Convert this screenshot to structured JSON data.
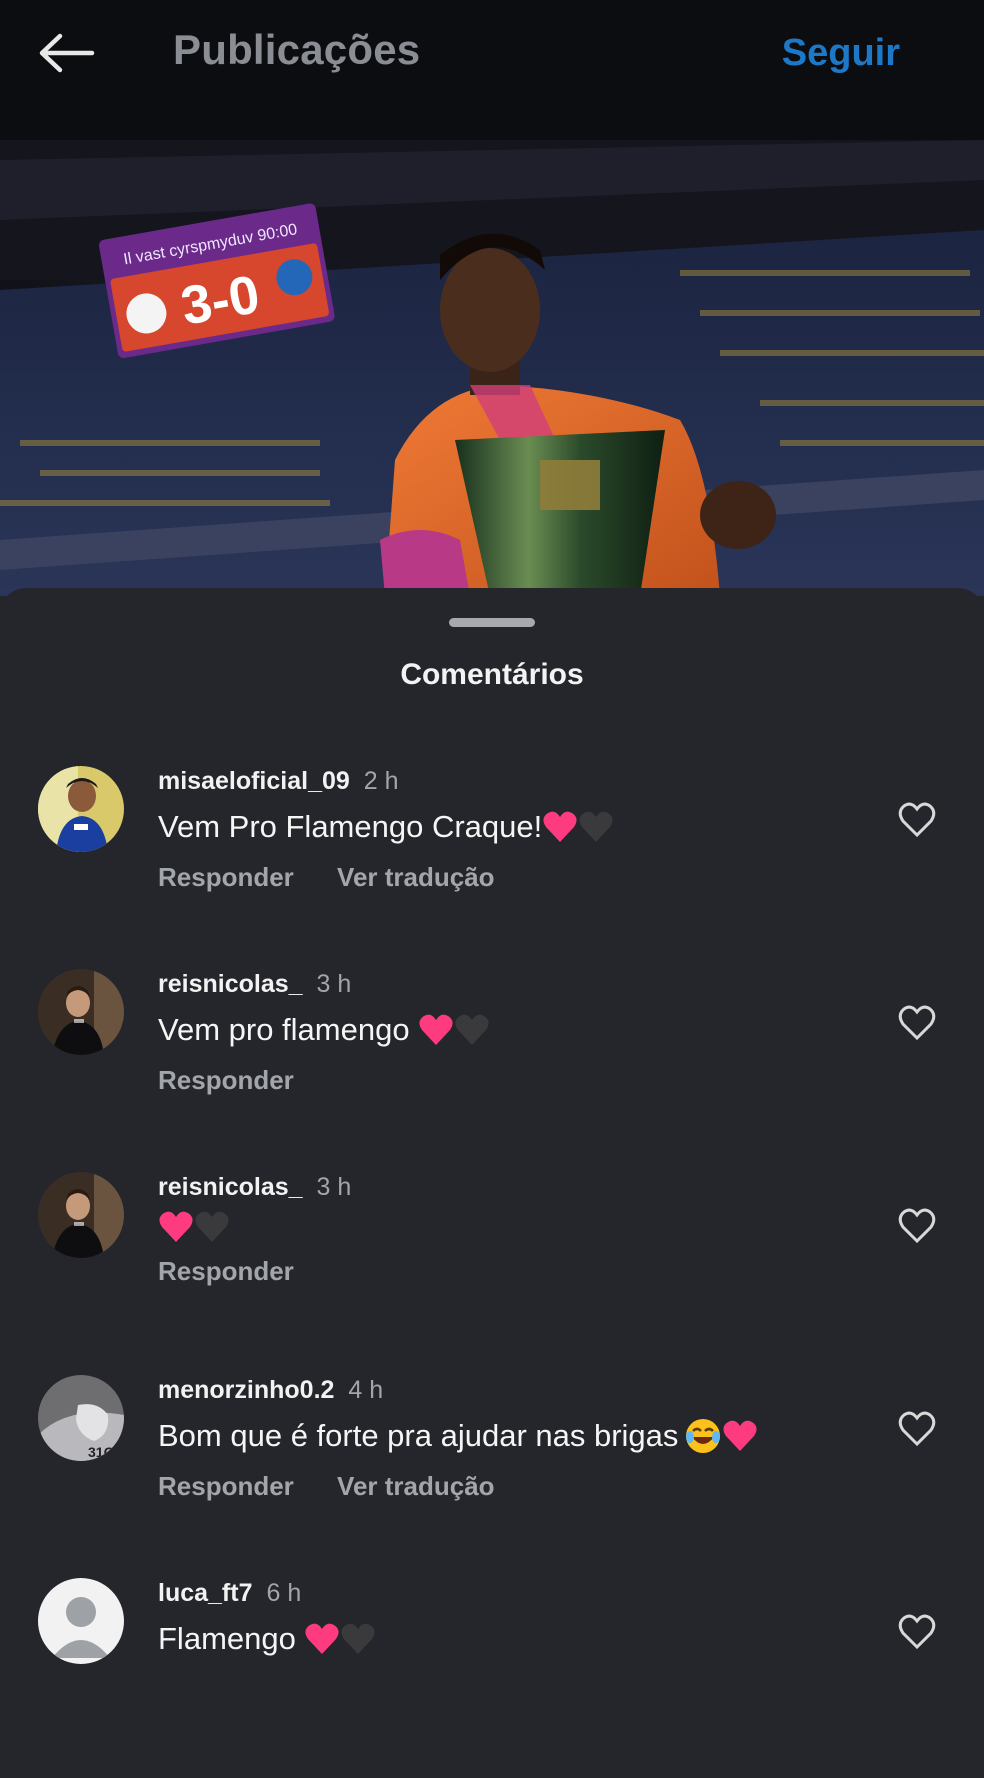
{
  "header": {
    "title": "Publicações",
    "follow_label": "Seguir"
  },
  "post": {
    "scoreboard_text": "3-0",
    "scoreboard_caption": "Il vast cyrspmyduv 90:00"
  },
  "sheet": {
    "title": "Comentários"
  },
  "comments": [
    {
      "username": "misaeloficial_09",
      "time": "2 h",
      "text": "Vem Pro Flamengo Craque!",
      "reply": "Responder",
      "translate": "Ver tradução"
    },
    {
      "username": "reisnicolas_",
      "time": "3 h",
      "text": "Vem pro flamengo ",
      "reply": "Responder"
    },
    {
      "username": "reisnicolas_",
      "time": "3 h",
      "text": "",
      "reply": "Responder"
    },
    {
      "username": "menorzinho0.2",
      "time": "4 h",
      "text": "Bom que é forte pra ajudar nas brigas",
      "reply": "Responder",
      "translate": "Ver tradução"
    },
    {
      "username": "luca_ft7",
      "time": "6 h",
      "text": "Flamengo "
    }
  ],
  "colors": {
    "accent_blue": "#1e78c8",
    "heart_pink": "#ff3b7f",
    "heart_dark": "#3a3a3d"
  },
  "icons": [
    "back-arrow-icon",
    "like-heart-icon",
    "pink-heart-emoji",
    "black-heart-emoji",
    "laughing-emoji",
    "default-avatar-icon"
  ]
}
